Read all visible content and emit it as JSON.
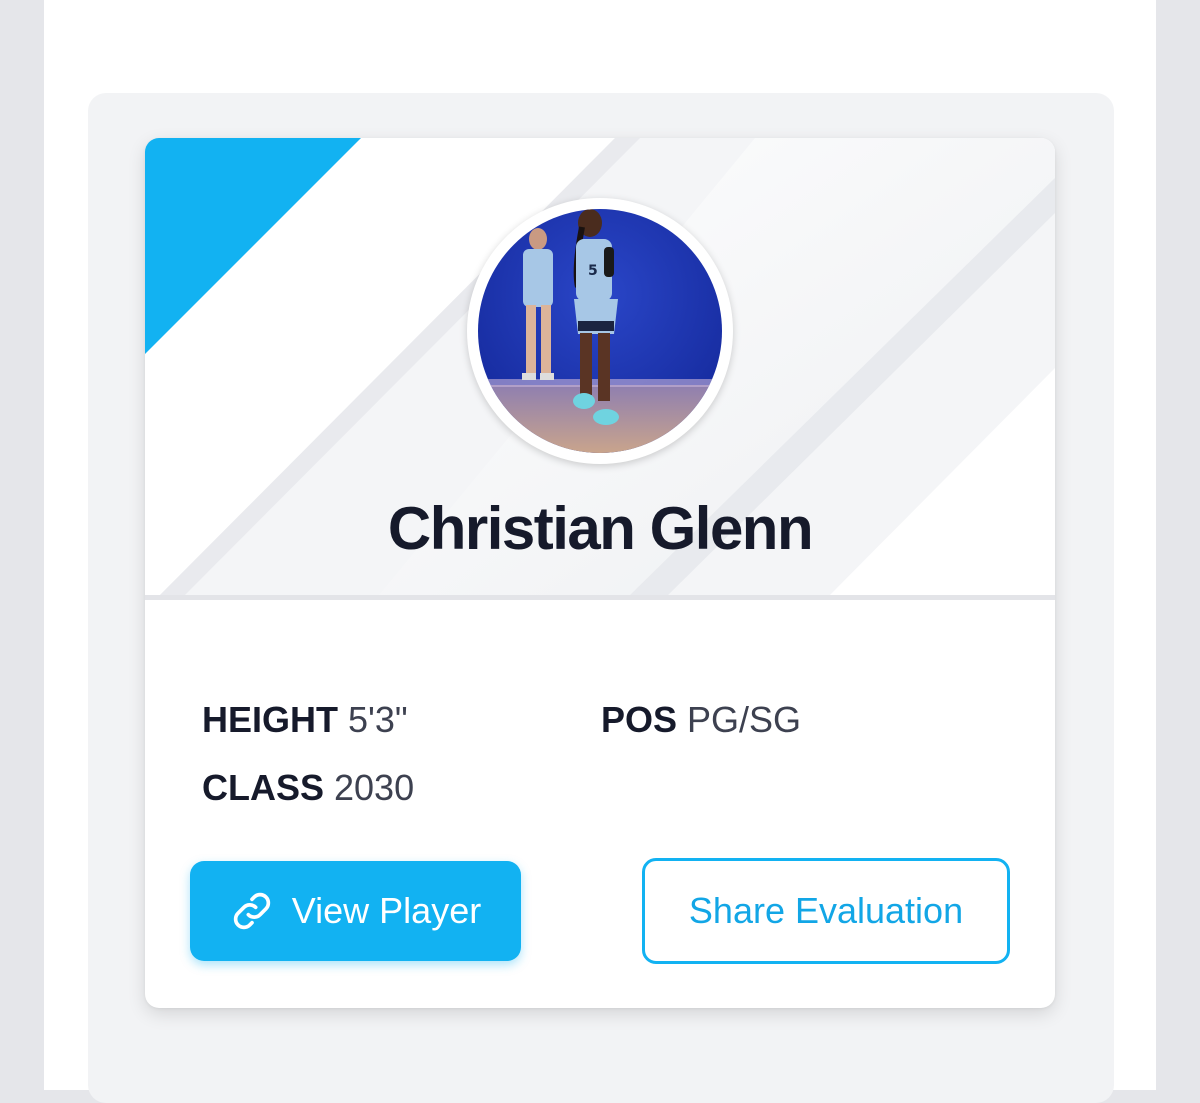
{
  "player": {
    "name": "Christian Glenn",
    "avatar_alt": "player-photo"
  },
  "stats": {
    "height_label": "HEIGHT",
    "height_value": "5'3\"",
    "class_label": "CLASS",
    "class_value": "2030",
    "pos_label": "POS",
    "pos_value": "PG/SG"
  },
  "actions": {
    "view_player_label": "View Player",
    "view_player_icon": "link-icon",
    "share_label": "Share Evaluation"
  },
  "colors": {
    "accent": "#12b2f2",
    "name_text": "#161a2b"
  }
}
